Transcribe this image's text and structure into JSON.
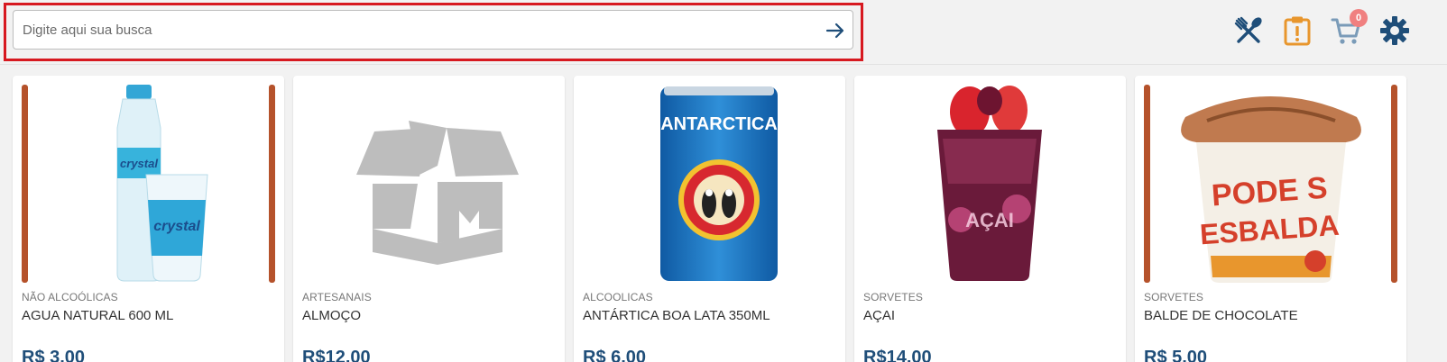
{
  "search": {
    "placeholder": "Digite aqui sua busca",
    "value": ""
  },
  "header_icons": {
    "menu_icon": "fork-spoon-icon",
    "orders_icon": "clipboard-alert-icon",
    "cart_icon": "cart-icon",
    "cart_count": "0",
    "settings_icon": "gear-icon"
  },
  "colors": {
    "primary": "#1f4e79",
    "accent_orange": "#e8962d",
    "cart_badge": "#f08080",
    "highlight_border": "#d71920"
  },
  "products": [
    {
      "category": "NÃO ALCOÓLICAS",
      "name": "AGUA NATURAL 600 ML",
      "price": "R$ 3,00",
      "image": "water-bottles"
    },
    {
      "category": "ARTESANAIS",
      "name": "ALMOÇO",
      "price": "R$12,00",
      "image": "placeholder-box"
    },
    {
      "category": "ALCOOLICAS",
      "name": "ANTÁRTICA BOA LATA 350ML",
      "price": "R$ 6,00",
      "image": "beer-can",
      "image_text": "ANTARCTICA"
    },
    {
      "category": "SORVETES",
      "name": "AÇAI",
      "price": "R$14,00",
      "image": "acai-cup",
      "image_text": "AÇAI"
    },
    {
      "category": "SORVETES",
      "name": "BALDE DE CHOCOLATE",
      "price": "R$ 5,00",
      "image": "ice-cream-bucket",
      "image_text": "PODE S ESBALDA"
    }
  ]
}
